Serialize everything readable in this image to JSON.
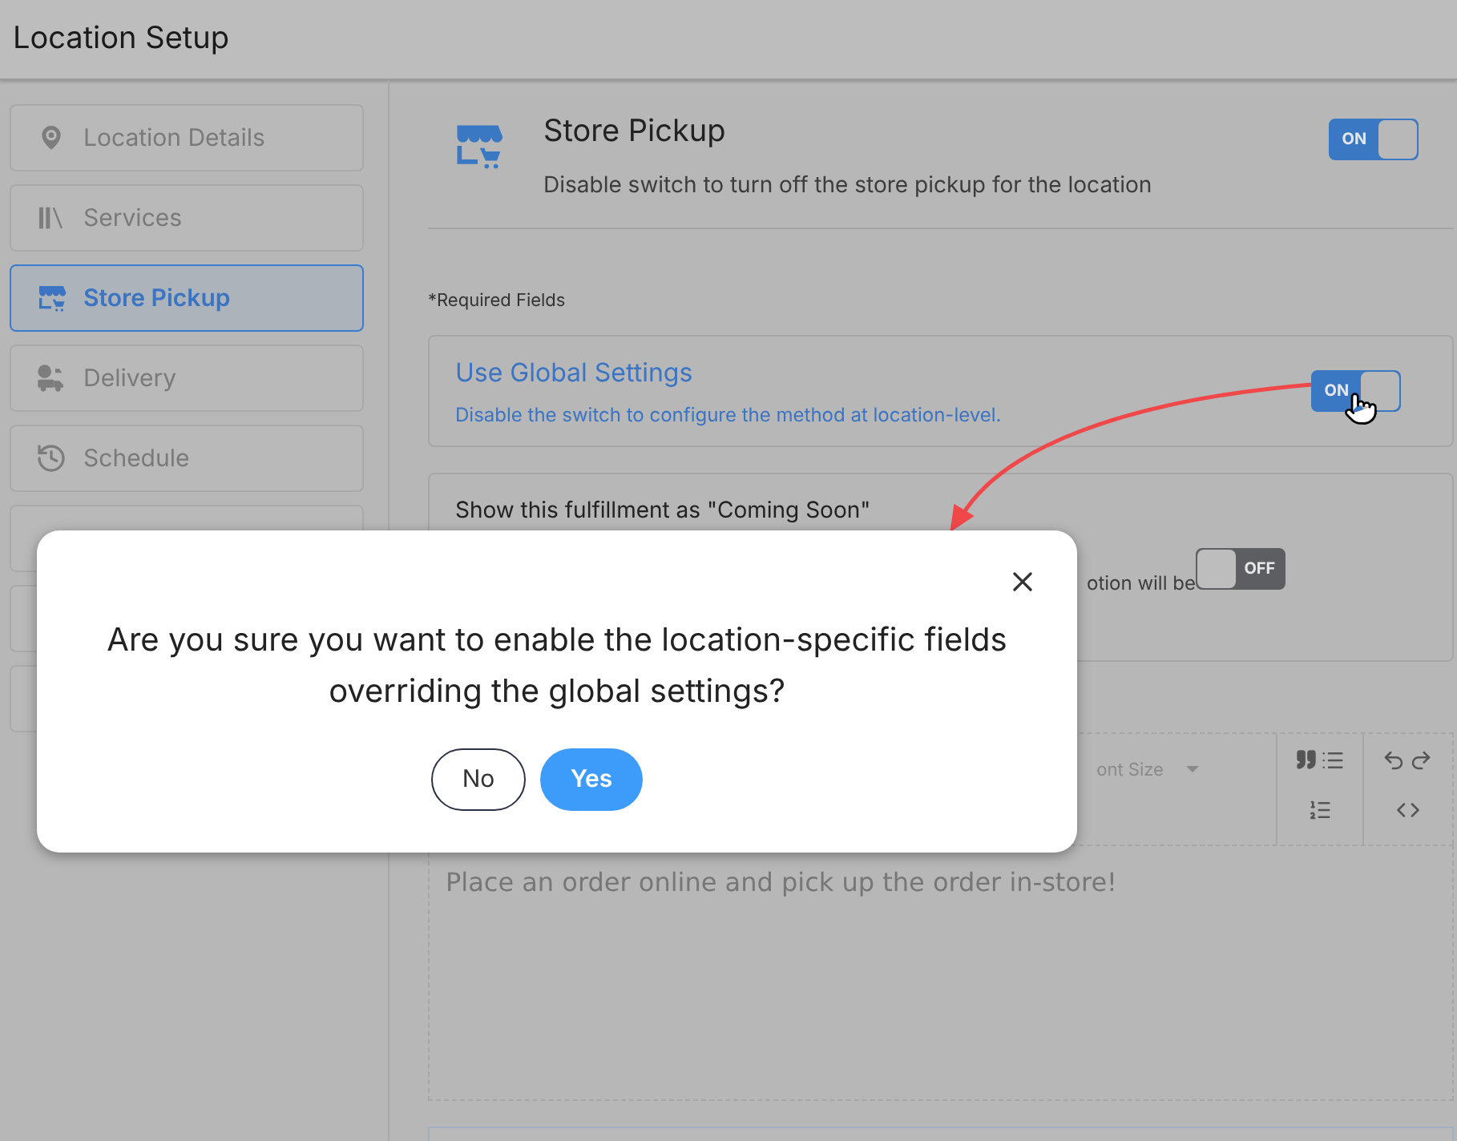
{
  "window": {
    "title": "Location Setup"
  },
  "sidebar": {
    "items": [
      {
        "label": "Location Details",
        "selected": false
      },
      {
        "label": "Services",
        "selected": false
      },
      {
        "label": "Store Pickup",
        "selected": true
      },
      {
        "label": "Delivery",
        "selected": false
      },
      {
        "label": "Schedule",
        "selected": false
      },
      {
        "selected": false
      },
      {
        "selected": false
      },
      {
        "selected": false
      }
    ]
  },
  "section": {
    "title": "Store Pickup",
    "description": "Disable switch to turn off the store pickup for the location",
    "toggle": {
      "on": true,
      "label": "ON"
    }
  },
  "required_note": "*Required Fields",
  "global_settings": {
    "title": "Use Global Settings",
    "description": "Disable the switch to configure the method at location-level.",
    "toggle": {
      "on": true,
      "label": "ON"
    }
  },
  "coming_soon": {
    "title": "Show this fulfillment as \"Coming Soon\"",
    "description": "otion will be",
    "toggle": {
      "on": false,
      "label": "OFF"
    }
  },
  "editor": {
    "font_size": "ont Size",
    "text": "Place an order online and pick up the order in-store!"
  },
  "dialog": {
    "message": "Are you sure you want to enable the location-specific fields overriding the global settings?",
    "buttons": [
      {
        "label": "No",
        "kind": "secondary"
      },
      {
        "label": "Yes",
        "kind": "primary"
      }
    ]
  }
}
